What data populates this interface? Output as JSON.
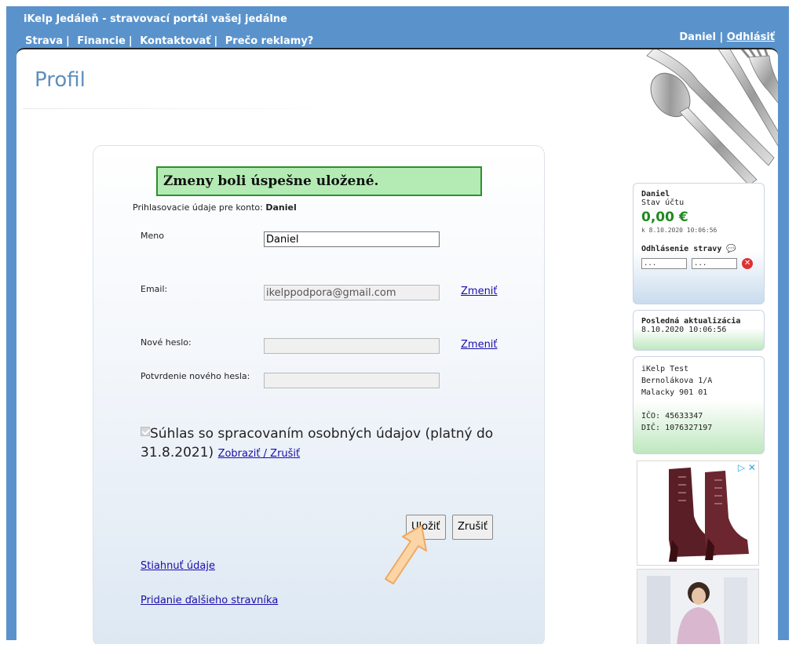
{
  "header": {
    "site_title": "iKelp Jedáleň - stravovací portál vašej jedálne",
    "nav": [
      {
        "label": "Strava"
      },
      {
        "label": "Financie"
      },
      {
        "label": "Kontaktovať"
      },
      {
        "label": "Prečo reklamy?"
      }
    ],
    "nav_sep": "|",
    "user_name": "Daniel",
    "user_sep": "|",
    "logout_label": "Odhlásiť"
  },
  "page": {
    "title": "Profil"
  },
  "form": {
    "success_message": "Zmeny boli úspešne uložené.",
    "account_prefix": "Prihlasovacie údaje pre konto:",
    "account_name": "Daniel",
    "name_label": "Meno",
    "name_value": "Daniel",
    "email_label": "Email:",
    "email_value": "ikelppodpora@gmail.com",
    "email_change": "Zmeniť",
    "new_password_label": "Nové heslo:",
    "password_change": "Zmeniť",
    "confirm_password_label": "Potvrdenie nového hesla:",
    "consent_text": "Súhlas so spracovaním osobných údajov (platný do 31.8.2021)",
    "consent_link": "Zobraziť / Zrušiť",
    "save_label": "Uložiť",
    "cancel_label": "Zrušiť",
    "download_link": "Stiahnuť údaje",
    "add_diner_link": "Pridanie ďalšieho stravníka"
  },
  "sidebar": {
    "account": {
      "name": "Daniel",
      "status_label": "Stav účtu",
      "balance": "0,00 €",
      "balance_date": "k 8.10.2020 10:06:56",
      "unsubscribe_label": "Odhlásenie stravy",
      "date_from": "...",
      "date_to": "..."
    },
    "update": {
      "label": "Posledná aktualizácia",
      "value": "8.10.2020 10:06:56"
    },
    "company": {
      "name": "iKelp Test",
      "street": "Bernolákova 1/A",
      "city": "Malacky 901 01",
      "ico": "IČO: 45633347",
      "dic": "DIČ: 1076327197"
    }
  },
  "colors": {
    "header_blue": "#5a93cc",
    "title_blue": "#5f8fbe",
    "success_bg": "#b4ebb4",
    "balance_green": "#1f8a1f",
    "link": "#1a0dab"
  }
}
